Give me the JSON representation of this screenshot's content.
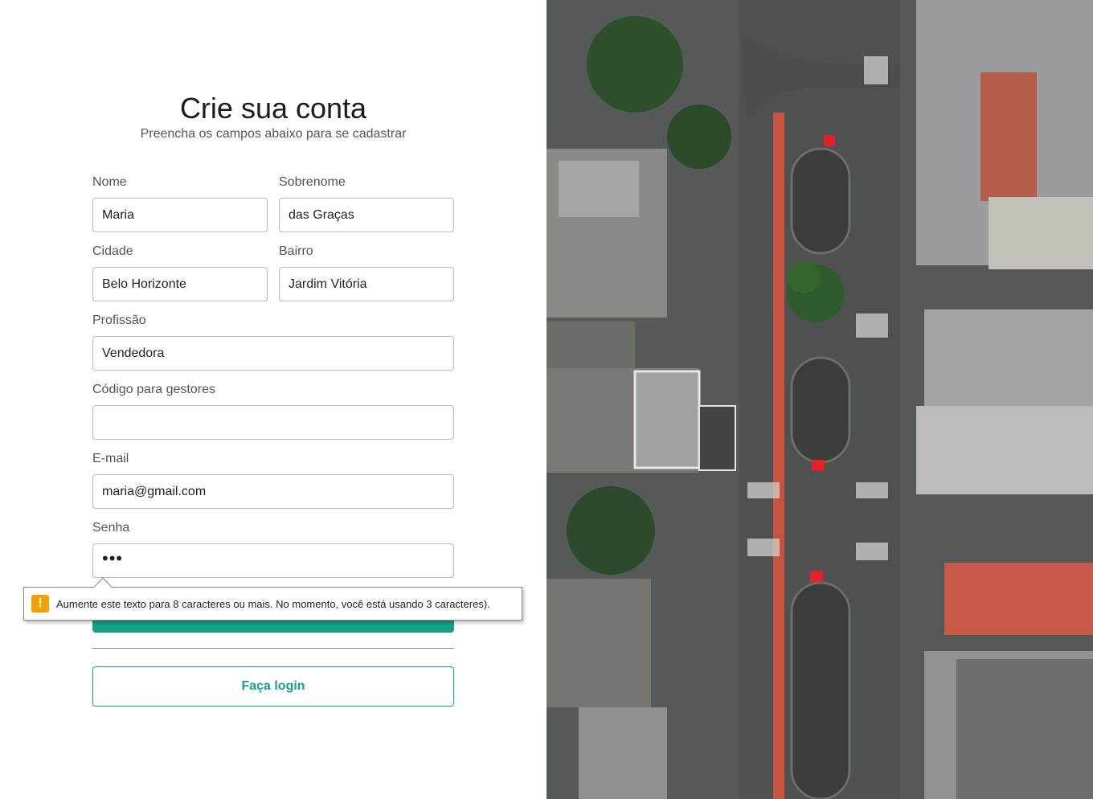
{
  "form": {
    "title": "Crie sua conta",
    "subtitle": "Preencha os campos abaixo para se cadastrar",
    "fields": {
      "nome": {
        "label": "Nome",
        "value": "Maria"
      },
      "sobrenome": {
        "label": "Sobrenome",
        "value": "das Graças"
      },
      "cidade": {
        "label": "Cidade",
        "value": "Belo Horizonte"
      },
      "bairro": {
        "label": "Bairro",
        "value": "Jardim Vitória"
      },
      "profissao": {
        "label": "Profissão",
        "value": "Vendedora"
      },
      "codigo": {
        "label": "Código para gestores",
        "value": ""
      },
      "email": {
        "label": "E-mail",
        "value": "maria@gmail.com"
      },
      "senha": {
        "label": "Senha",
        "value": "•••"
      }
    },
    "validation_message": "Aumente este texto para 8 caracteres ou mais. No momento, você está usando 3 caracteres).",
    "login_label": "Faça login"
  },
  "colors": {
    "accent": "#16a085",
    "warning": "#f4a100",
    "bike_lane": "#c7523f"
  },
  "icons": {
    "warning": "warning-icon"
  }
}
